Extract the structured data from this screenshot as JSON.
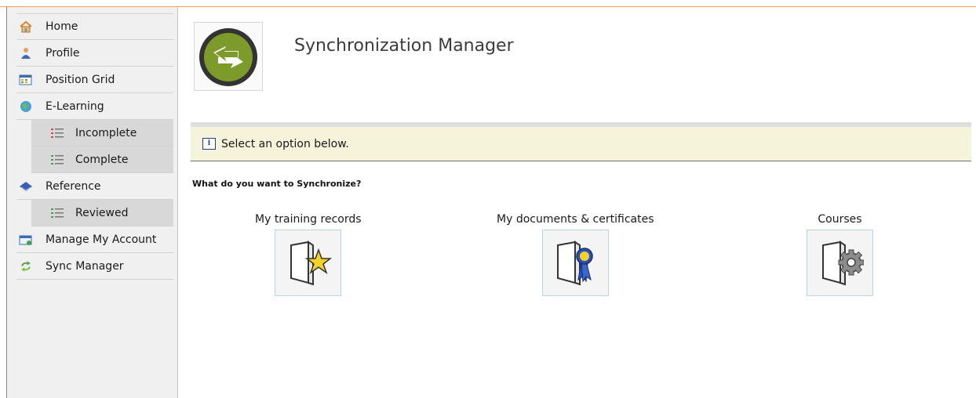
{
  "sidebar": {
    "items": [
      {
        "label": "Home",
        "icon": "home-icon"
      },
      {
        "label": "Profile",
        "icon": "profile-icon"
      },
      {
        "label": "Position Grid",
        "icon": "grid-icon"
      },
      {
        "label": "E-Learning",
        "icon": "globe-icon"
      },
      {
        "label": "Incomplete",
        "icon": "list-icon"
      },
      {
        "label": "Complete",
        "icon": "list-icon"
      },
      {
        "label": "Reference",
        "icon": "book-icon"
      },
      {
        "label": "Reviewed",
        "icon": "list-icon"
      },
      {
        "label": "Manage My Account",
        "icon": "account-icon"
      },
      {
        "label": "Sync Manager",
        "icon": "sync-icon"
      }
    ]
  },
  "header": {
    "title": "Synchronization Manager",
    "logo_icon": "sync-logo-icon"
  },
  "info": {
    "icon": "info-icon",
    "text": "Select an option below."
  },
  "main": {
    "question": "What do you want to Synchronize?",
    "options": [
      {
        "label": "My training records",
        "icon": "folder-star-icon"
      },
      {
        "label": "My documents & certificates",
        "icon": "folder-ribbon-icon"
      },
      {
        "label": "Courses",
        "icon": "folder-gear-icon"
      }
    ]
  },
  "colors": {
    "accent_top": "#f0a040",
    "sidebar_bg": "#f0f0f0",
    "sub_item_bg": "#d8d8d8",
    "info_bg": "#f5f3d9",
    "logo_green": "#7d9b2a",
    "logo_dark": "#333333"
  }
}
